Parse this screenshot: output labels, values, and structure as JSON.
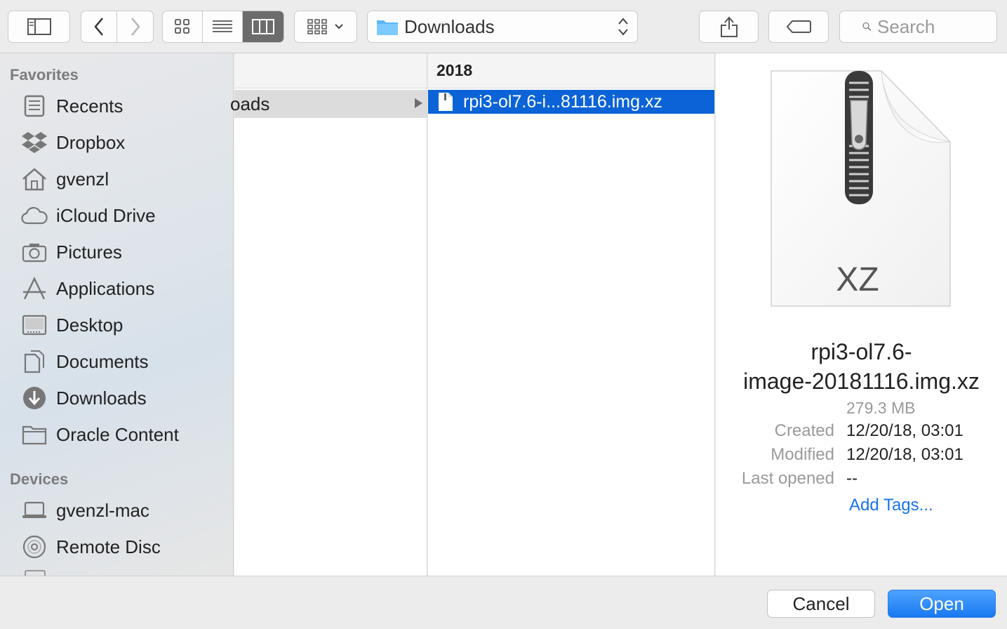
{
  "toolbar": {
    "path_label": "Downloads",
    "search_placeholder": "Search"
  },
  "sidebar": {
    "favorites_header": "Favorites",
    "favorites": [
      {
        "label": "Recents",
        "icon": "recents-icon"
      },
      {
        "label": "Dropbox",
        "icon": "dropbox-icon"
      },
      {
        "label": "gvenzl",
        "icon": "home-icon"
      },
      {
        "label": "iCloud Drive",
        "icon": "cloud-icon"
      },
      {
        "label": "Pictures",
        "icon": "camera-icon"
      },
      {
        "label": "Applications",
        "icon": "applications-icon"
      },
      {
        "label": "Desktop",
        "icon": "desktop-icon"
      },
      {
        "label": "Documents",
        "icon": "document-icon"
      },
      {
        "label": "Downloads",
        "icon": "download-icon"
      },
      {
        "label": "Oracle Content",
        "icon": "folder-icon"
      }
    ],
    "devices_header": "Devices",
    "devices": [
      {
        "label": "gvenzl-mac",
        "icon": "laptop-icon"
      },
      {
        "label": "Remote Disc",
        "icon": "disc-icon"
      }
    ]
  },
  "columns": {
    "col1_row": "oads",
    "col2_header": "2018",
    "col2_row": "rpi3-ol7.6-i...81116.img.xz"
  },
  "preview": {
    "badge": "XZ",
    "name_line1": "rpi3-ol7.6-",
    "name_line2": "image-20181116.img.xz",
    "size": "279.3 MB",
    "created_label": "Created",
    "created_value": "12/20/18, 03:01",
    "modified_label": "Modified",
    "modified_value": "12/20/18, 03:01",
    "last_opened_label": "Last opened",
    "last_opened_value": "--",
    "add_tags": "Add Tags..."
  },
  "buttons": {
    "cancel": "Cancel",
    "open": "Open"
  }
}
